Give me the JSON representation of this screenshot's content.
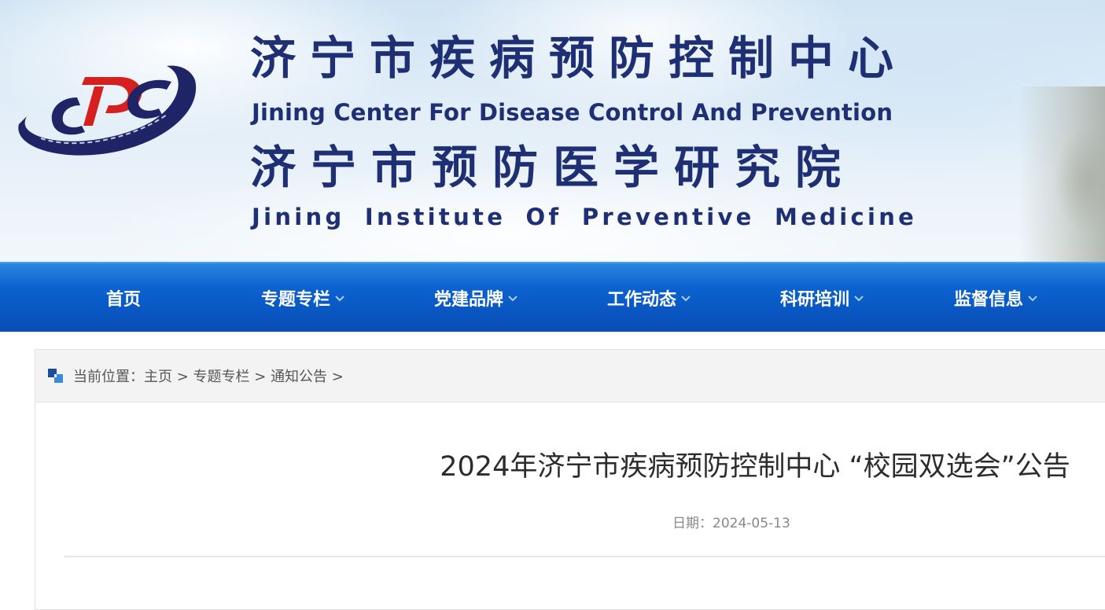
{
  "header": {
    "title_cn": "济宁市疾病预防控制中心",
    "title_en": "Jining Center For Disease Control And Prevention",
    "subtitle_cn": "济宁市预防医学研究院",
    "subtitle_en": "Jining Institute Of Preventive Medicine",
    "logo_text": "CDC",
    "logo_icon": "cdc-logo"
  },
  "nav": {
    "items": [
      {
        "label": "首页",
        "has_dropdown": false
      },
      {
        "label": "专题专栏",
        "has_dropdown": true
      },
      {
        "label": "党建品牌",
        "has_dropdown": true
      },
      {
        "label": "工作动态",
        "has_dropdown": true
      },
      {
        "label": "科研培训",
        "has_dropdown": true
      },
      {
        "label": "监督信息",
        "has_dropdown": true
      }
    ],
    "dropdown_icon": "chevron-down-icon"
  },
  "breadcrumb": {
    "prefix": "当前位置：",
    "items": [
      "主页",
      "专题专栏",
      "通知公告"
    ],
    "separator": " > ",
    "icon": "location-squares-icon"
  },
  "article": {
    "title": "2024年济宁市疾病预防控制中心 “校园双选会”公告",
    "date_label": "日期：",
    "date": "2024-05-13"
  },
  "colors": {
    "title_blue": "#1f2f74",
    "nav_blue": "#0b62cf",
    "logo_red": "#d6201f",
    "text_dark": "#2c2c2c",
    "text_gray": "#888888"
  }
}
